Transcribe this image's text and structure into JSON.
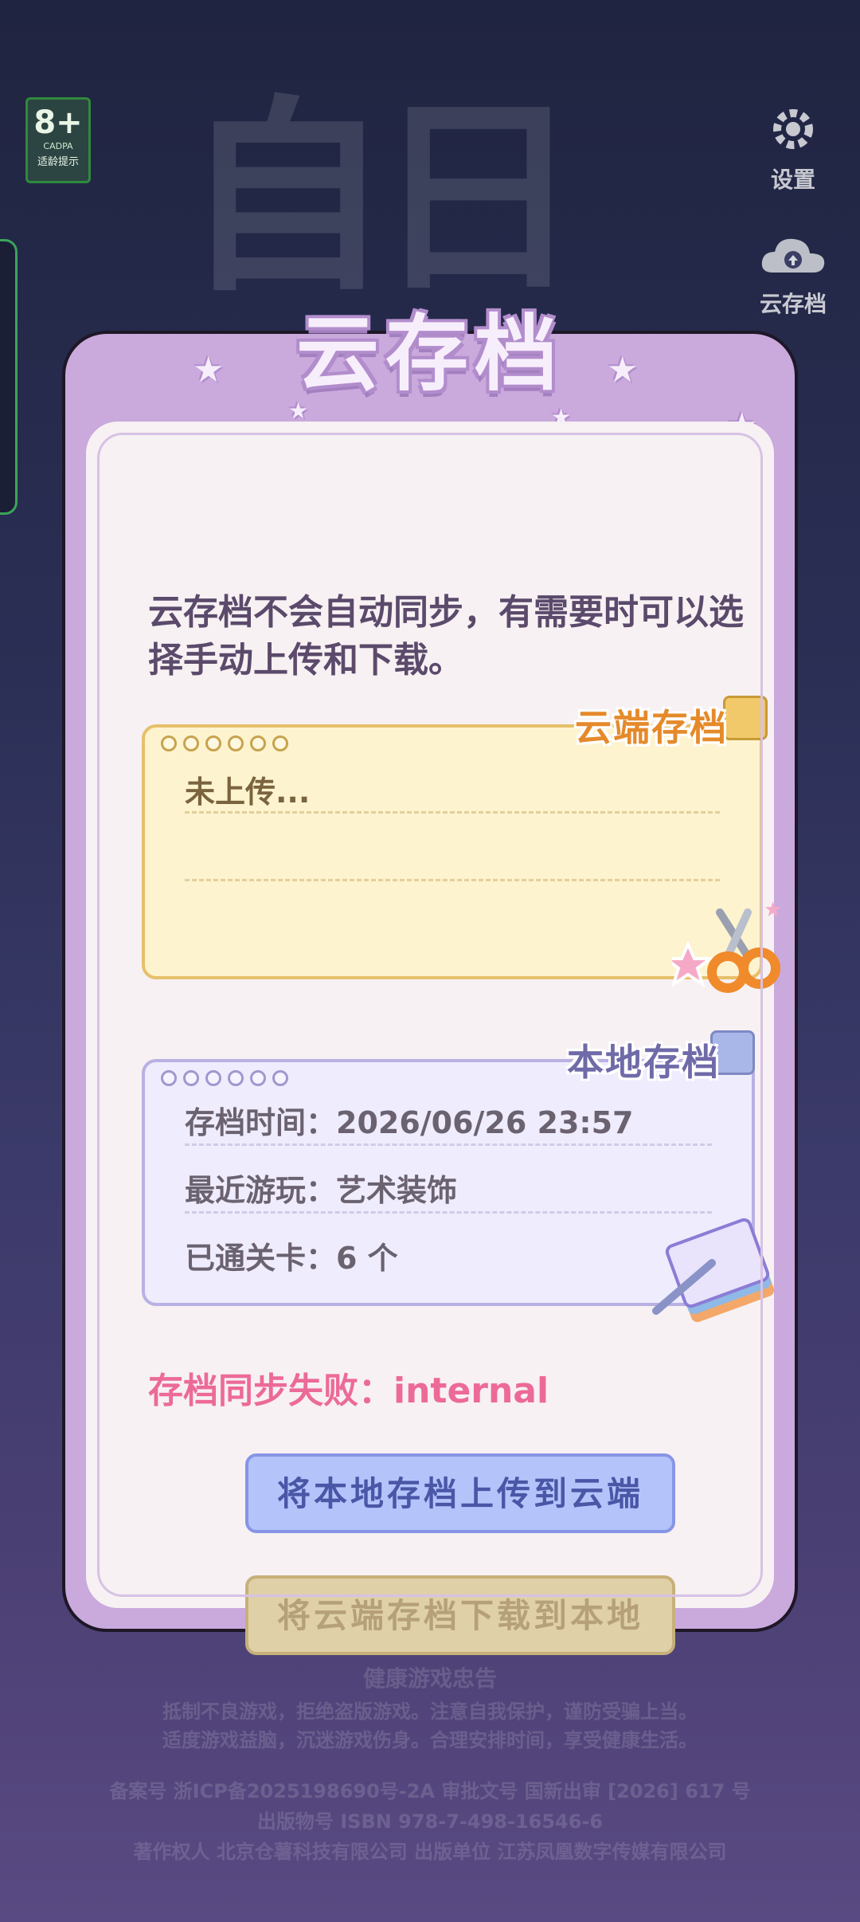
{
  "background": {
    "age_rating": {
      "value": "8+",
      "org": "CADPA",
      "hint": "适龄提示"
    },
    "settings": {
      "label": "设置",
      "icon": "gear-icon"
    },
    "cloud_save": {
      "label": "云存档",
      "icon": "cloud-upload-icon"
    }
  },
  "dialog": {
    "title": "云存档",
    "description": "云存档不会自动同步，有需要时可以选择手动上传和下载。",
    "cloud_card": {
      "tag": "云端存档",
      "status": "未上传..."
    },
    "local_card": {
      "tag": "本地存档",
      "save_time": "存档时间：2026/06/26 23:57",
      "recent_play": "最近游玩：艺术装饰",
      "levels_cleared": "已通关卡：6 个"
    },
    "error_text": "存档同步失败：internal",
    "upload_button": "将本地存档上传到云端",
    "download_button": "将云端存档下载到本地"
  },
  "footer": {
    "title": "健康游戏忠告",
    "line1": "抵制不良游戏，拒绝盗版游戏。注意自我保护，谨防受骗上当。",
    "line2": "适度游戏益脑，沉迷游戏伤身。合理安排时间，享受健康生活。",
    "line3": "备案号 浙ICP备2025198690号-2A 审批文号 国新出审 [2026] 617 号",
    "line4": "出版物号 ISBN 978-7-498-16546-6",
    "line5": "著作权人 北京仓薯科技有限公司 出版单位 江苏凤凰数字传媒有限公司"
  },
  "colors": {
    "dialog_frame": "#caa9dc",
    "error": "#ec6a98",
    "upload_button": "#b4c4fb",
    "download_button_disabled": "#dfd0a8"
  }
}
